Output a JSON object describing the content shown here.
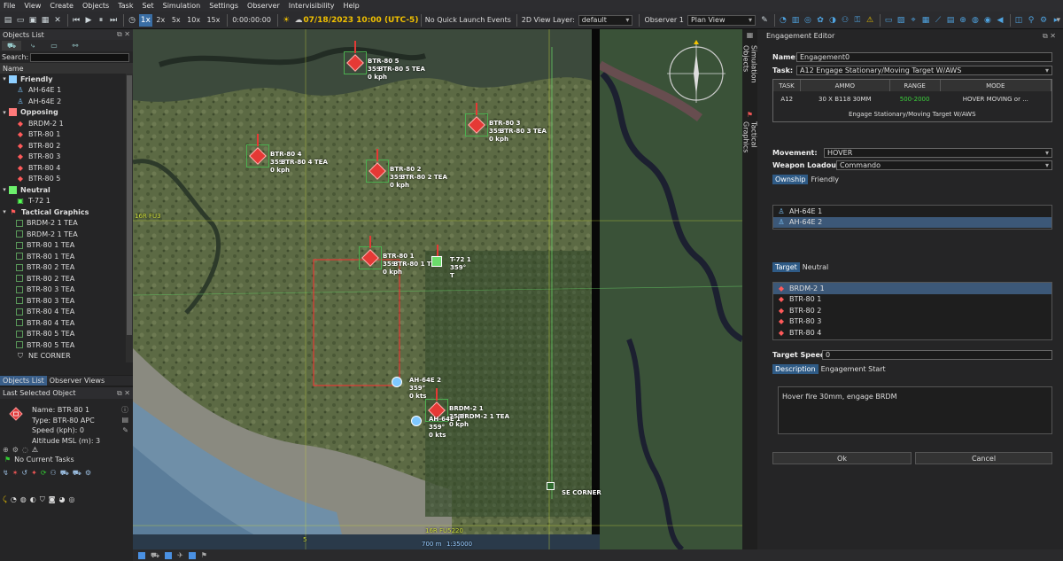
{
  "menu": [
    "File",
    "View",
    "Create",
    "Objects",
    "Task",
    "Set",
    "Simulation",
    "Settings",
    "Observer",
    "Intervisibility",
    "Help"
  ],
  "toolbar": {
    "speeds": [
      "1x",
      "2x",
      "5x",
      "10x",
      "15x"
    ],
    "time": "0:00:00:00",
    "datetime": "07/18/2023 10:00 (UTC-5)",
    "quick_launch": "No Quick Launch Events",
    "view_layer_label": "2D View Layer:",
    "view_layer_value": "default",
    "observer_label": "Observer 1",
    "observer_value": "Plan View"
  },
  "objects_list": {
    "title": "Objects List",
    "search_label": "Search:",
    "column": "Name",
    "groups": [
      {
        "label": "Friendly",
        "color": "#8ecfff",
        "kind": "f",
        "items": [
          "AH-64E 1",
          "AH-64E 2"
        ]
      },
      {
        "label": "Opposing",
        "color": "#ff7a7a",
        "kind": "o",
        "items": [
          "BRDM-2 1",
          "BTR-80 1",
          "BTR-80 2",
          "BTR-80 3",
          "BTR-80 4",
          "BTR-80 5"
        ]
      },
      {
        "label": "Neutral",
        "color": "#6cf06c",
        "kind": "n",
        "items": [
          "T-72 1"
        ]
      },
      {
        "label": "Tactical Graphics",
        "color": "",
        "kind": "t",
        "items": [
          "BRDM-2 1 TEA",
          "BRDM-2 1 TEA",
          "BTR-80 1 TEA",
          "BTR-80 1 TEA",
          "BTR-80 2 TEA",
          "BTR-80 2 TEA",
          "BTR-80 3 TEA",
          "BTR-80 3 TEA",
          "BTR-80 4 TEA",
          "BTR-80 4 TEA",
          "BTR-80 5 TEA",
          "BTR-80 5 TEA",
          "NE CORNER"
        ]
      }
    ]
  },
  "bottom_tabs": [
    "Objects List",
    "Observer Views"
  ],
  "last_selected": {
    "title": "Last Selected Object",
    "name": "Name: BTR-80 1",
    "type": "Type: BTR-80 APC",
    "speed": "Speed (kph): 0",
    "altitude": "Altitude MSL (m): 3",
    "tasks": "No Current Tasks"
  },
  "map": {
    "grid_label_1": "16R FU3",
    "grid_label_2": "16R FU5220",
    "scale": "700 m",
    "scale2": "1:35000",
    "tick": "5",
    "se_corner": "SE CORNER",
    "units": [
      {
        "name": "BTR-80 5",
        "hdg": "359°",
        "spd": "0 kph",
        "tea": "BTR-80 5 TEA",
        "kind": "o"
      },
      {
        "name": "BTR-80 3",
        "hdg": "359°",
        "spd": "0 kph",
        "tea": "BTR-80 3 TEA",
        "kind": "o"
      },
      {
        "name": "BTR-80 4",
        "hdg": "359°",
        "spd": "0 kph",
        "tea": "BTR-80 4 TEA",
        "kind": "o"
      },
      {
        "name": "BTR-80 2",
        "hdg": "359°",
        "spd": "0 kph",
        "tea": "BTR-80 2 TEA",
        "kind": "o"
      },
      {
        "name": "BTR-80 1",
        "hdg": "359°",
        "spd": "0 kph",
        "tea": "BTR-80 1 TEA",
        "kind": "o"
      },
      {
        "name": "T-72 1",
        "hdg": "359°",
        "spd": "T",
        "tea": "",
        "kind": "n"
      },
      {
        "name": "AH-64E 2",
        "hdg": "359°",
        "spd": "0 kts",
        "tea": "",
        "kind": "f"
      },
      {
        "name": "BRDM-2 1",
        "hdg": "359°",
        "spd": "0 kph",
        "tea": "BRDM-2 1 TEA",
        "kind": "o"
      },
      {
        "name": "AH-64E 1",
        "hdg": "359°",
        "spd": "0 kts",
        "tea": "",
        "kind": "f"
      }
    ]
  },
  "side_tabs": [
    "Simulation Objects",
    "Tactical Graphics"
  ],
  "engagement": {
    "title": "Engagement Editor",
    "name_label": "Name:",
    "name_value": "Engagement0",
    "task_label": "Task:",
    "task_value": "A12 Engage Stationary/Moving Target W/AWS",
    "table_headers": [
      "TASK",
      "AMMO",
      "RANGE",
      "MODE"
    ],
    "table_row": [
      "A12",
      "30 X B118 30MM",
      "500-2000",
      "HOVER MOVING or ..."
    ],
    "table_desc": "Engage Stationary/Moving Target W/AWS",
    "range_color": "#3cd23c",
    "movement_label": "Movement:",
    "movement_value": "HOVER",
    "loadout_label": "Weapon Loadout:",
    "loadout_value": "Commando",
    "ownship_tabs": [
      "Ownship",
      "Friendly"
    ],
    "ownship_list": [
      "AH-64E 1",
      "AH-64E 2"
    ],
    "target_tabs": [
      "Target",
      "Neutral"
    ],
    "target_list": [
      "BRDM-2 1",
      "BTR-80 1",
      "BTR-80 2",
      "BTR-80 3",
      "BTR-80 4"
    ],
    "speed_label": "Target Speed",
    "speed_value": "0",
    "desc_tabs": [
      "Description",
      "Engagement Start"
    ],
    "desc_text": "Hover fire 30mm, engage BRDM",
    "ok": "Ok",
    "cancel": "Cancel"
  }
}
